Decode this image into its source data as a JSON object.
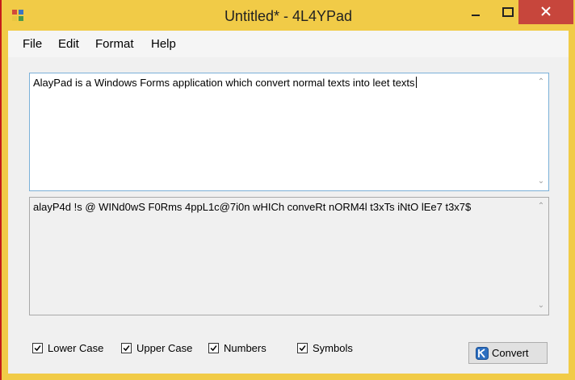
{
  "window": {
    "title": "Untitled* - 4L4YPad"
  },
  "menu": {
    "items": [
      "File",
      "Edit",
      "Format",
      "Help"
    ]
  },
  "input": {
    "text": "AlayPad is a Windows Forms application which convert normal texts into leet texts"
  },
  "output": {
    "text": "alayP4d !s @ WINd0wS F0Rms 4ppL1c@7i0n wHICh conveRt nORM4l t3xTs iNtO lEe7 t3x7$"
  },
  "options": [
    {
      "label": "Lower Case",
      "checked": true
    },
    {
      "label": "Upper Case",
      "checked": true
    },
    {
      "label": "Numbers",
      "checked": true
    },
    {
      "label": "Symbols",
      "checked": true
    }
  ],
  "convert_button": {
    "label": "Convert"
  },
  "colors": {
    "frame": "#f1cb47",
    "close": "#c7463c",
    "input_border": "#7ab0d8"
  }
}
